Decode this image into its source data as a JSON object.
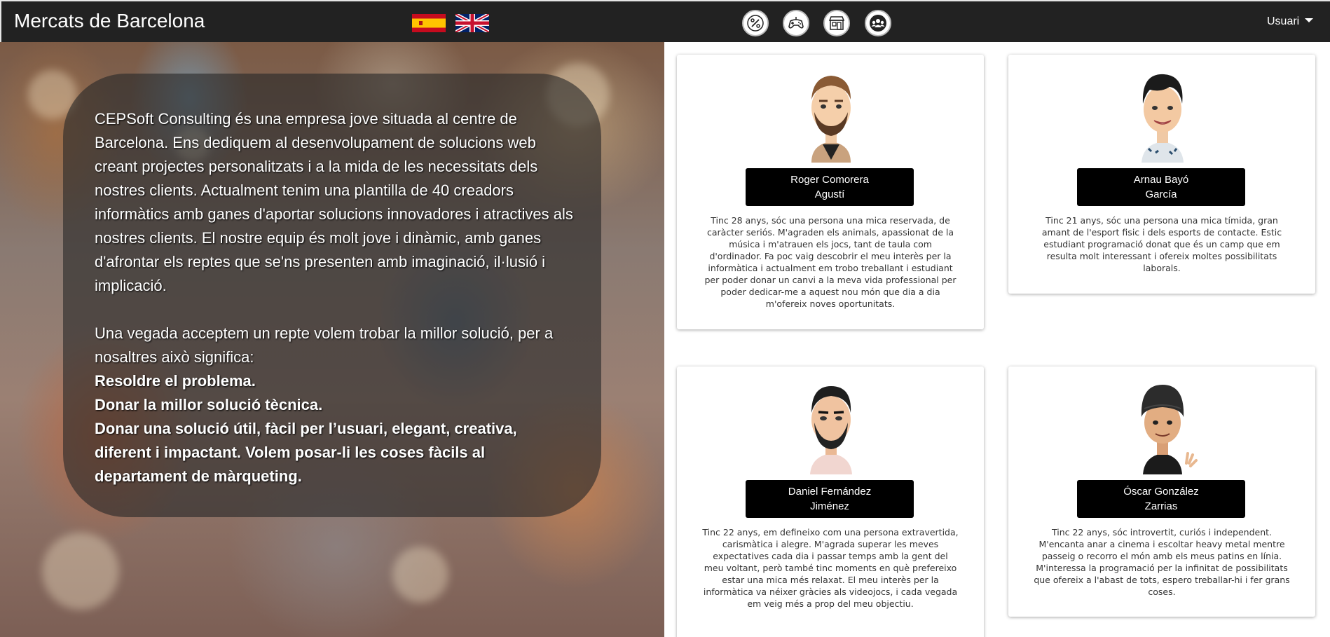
{
  "navbar": {
    "brand": "Mercats de Barcelona",
    "user_label": "Usuari",
    "icons": [
      "percent-icon",
      "gamepad-icon",
      "market-stall-icon",
      "team-icon"
    ],
    "flags": [
      "spain-flag",
      "uk-flag"
    ]
  },
  "hero": {
    "paragraph1": "CEPSoft Consulting és una empresa jove situada al centre de Barcelona. Ens dediquem al desenvolupament de solucions web creant projectes personalitzats i a la mida de les necessitats dels nostres clients. Actualment tenim una plantilla de 40 creadors informàtics amb ganes d'aportar solucions innovadores i atractives als nostres clients. El nostre equip és molt jove i dinàmic, amb ganes d'afrontar els reptes que se'ns presenten amb imaginació, il·lusió i implicació.",
    "paragraph2": "Una vegada acceptem un repte volem trobar la millor solució, per a nosaltres això significa:",
    "bold1": "Resoldre el problema.",
    "bold2": "Donar la millor solució tècnica.",
    "bold3": "Donar una solució útil, fàcil per l’usuari, elegant, creativa, diferent i impactant. Volem posar-li les coses fàcils al departament de màrqueting."
  },
  "team": [
    {
      "name_line1": "Roger Comorera",
      "name_line2": "Agustí",
      "bio": "Tinc 28 anys, sóc una persona una mica reservada, de caràcter seriós. M'agraden els animals, apassionat de la música i m'atrauen els jocs, tant de taula com d'ordinador. Fa poc vaig descobrir el meu interès per la informàtica i actualment em trobo treballant i estudiant per poder donar un canvi a la meva vida professional per poder dedicar-me a aquest nou món que dia a dia m'ofereix noves oportunitats."
    },
    {
      "name_line1": "Arnau Bayó",
      "name_line2": "García",
      "bio": "Tinc 21 anys, sóc una persona una mica tímida, gran amant de l'esport fisic i dels esports de contacte. Estic estudiant programació donat que és un camp que em resulta molt interessant i ofereix moltes possibilitats laborals."
    },
    {
      "name_line1": "Daniel Fernández",
      "name_line2": "Jiménez",
      "bio": "Tinc 22 anys, em defineixo com una persona extravertida, carismàtica i alegre. M'agrada superar les meves expectatives cada dia i passar temps amb la gent del meu voltant, però també tinc moments en què prefereixo estar una mica més relaxat. El meu interès per la informàtica va néixer gràcies als videojocs, i cada vegada em veig més a prop del meu objectiu."
    },
    {
      "name_line1": "Óscar González",
      "name_line2": "Zarrias",
      "bio": "Tinc 22 anys, sóc introvertit, curiós i independent. M'encanta anar a cinema i escoltar heavy metal mentre passeig o recorro el món amb els meus patins en línia. M'interessa la programació per la infinitat de possibilitats que ofereix a l'abast de tots, espero treballar-hi i fer grans coses."
    }
  ]
}
